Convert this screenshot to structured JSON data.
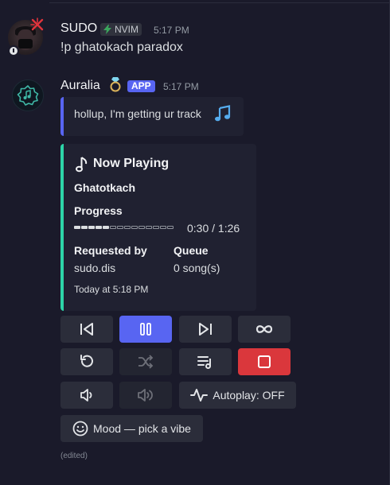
{
  "messages": [
    {
      "username": "SUDO",
      "tag": "NVIM",
      "time": "5:17 PM",
      "text": "!p ghatokach paradox"
    },
    {
      "username": "Auralia",
      "badge": "APP",
      "time": "5:17 PM",
      "reply_text": "hollup, I'm getting ur track",
      "embed": {
        "title": "Now Playing",
        "song": "Ghatotkach",
        "progress_label": "Progress",
        "progress_time": "0:30 / 1:26",
        "progress_fraction": 0.349,
        "requested_by_label": "Requested by",
        "requested_by": "sudo.dis",
        "queue_label": "Queue",
        "queue_value": "0 song(s)",
        "footer": "Today at 5:18 PM",
        "accent": "#2dd4a8"
      },
      "buttons": {
        "autoplay_label": "Autoplay: OFF",
        "mood_label": "Mood — pick a vibe"
      },
      "edited": "(edited)"
    }
  ],
  "colors": {
    "background": "#1a1a2a",
    "blurple": "#5865f2",
    "stop_red": "#da373c",
    "embed_bg": "#202131"
  }
}
